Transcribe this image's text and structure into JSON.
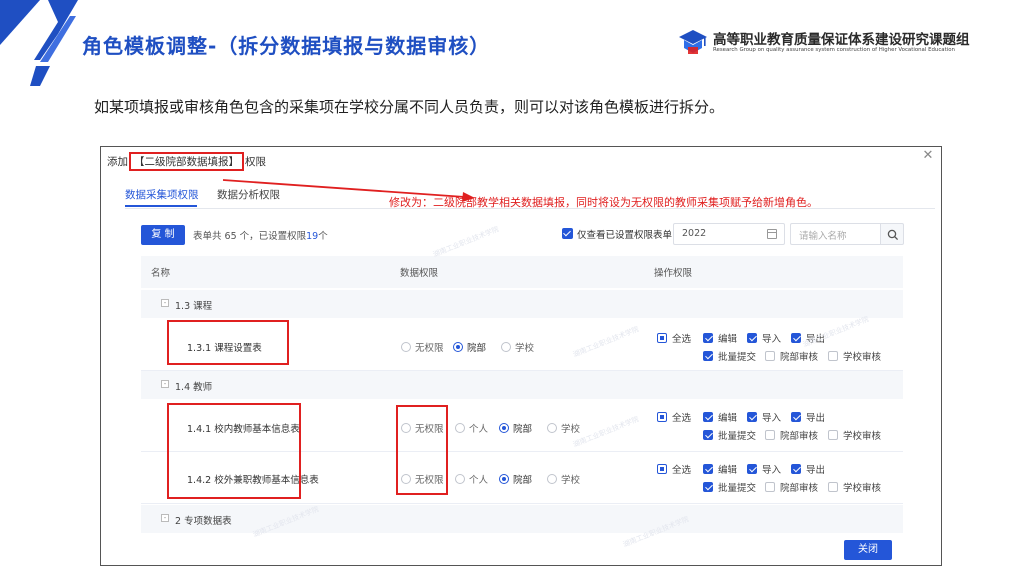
{
  "slide": {
    "title": "角色模板调整-（拆分数据填报与数据审核）",
    "logo_cn": "高等职业教育质量保证体系建设研究课题组",
    "logo_en": "Research Group on quality assurance system construction of Higher Vocational Education",
    "intro": "如某项填报或审核角色包含的采集项在学校分属不同人员负责，则可以对该角色模板进行拆分。"
  },
  "dialog": {
    "title_prefix": "添加",
    "title_highlight": "【二级院部数据填报】",
    "title_suffix": "权限",
    "tabs": [
      "数据采集项权限",
      "数据分析权限"
    ],
    "annotation": "修改为：二级院部教学相关数据填报，同时将设为无权限的教师采集项赋予给新增角色。",
    "toolbar": {
      "copy_label": "复 制",
      "stats_prefix": "表单共 65 个，已设置权限",
      "stats_count": "19",
      "stats_suffix": "个",
      "only_set_label": "仅查看已设置权限表单",
      "year": "2022",
      "search_placeholder": "请输入名称"
    },
    "columns": [
      "名称",
      "数据权限",
      "操作权限"
    ],
    "groups": [
      {
        "label": "1.3 课程",
        "rows": [
          {
            "name": "1.3.1 课程设置表",
            "data_options": [
              "无权限",
              "院部",
              "学校"
            ],
            "data_selected": "院部",
            "ops": [
              "全选",
              "编辑",
              "导入",
              "导出",
              "批量提交",
              "院部审核",
              "学校审核"
            ]
          }
        ]
      },
      {
        "label": "1.4 教师",
        "rows": [
          {
            "name": "1.4.1 校内教师基本信息表",
            "data_options": [
              "无权限",
              "个人",
              "院部",
              "学校"
            ],
            "data_selected": "院部",
            "ops": [
              "全选",
              "编辑",
              "导入",
              "导出",
              "批量提交",
              "院部审核",
              "学校审核"
            ]
          },
          {
            "name": "1.4.2 校外兼职教师基本信息表",
            "data_options": [
              "无权限",
              "个人",
              "院部",
              "学校"
            ],
            "data_selected": "院部",
            "ops": [
              "全选",
              "编辑",
              "导入",
              "导出",
              "批量提交",
              "院部审核",
              "学校审核"
            ]
          }
        ]
      },
      {
        "label": "2 专项数据表"
      }
    ],
    "close_label": "关闭",
    "watermark": "湖南工业职业技术学院",
    "colors": {
      "accent": "#2456d8",
      "annotation": "#e02020",
      "title": "#1f4fc2"
    }
  }
}
